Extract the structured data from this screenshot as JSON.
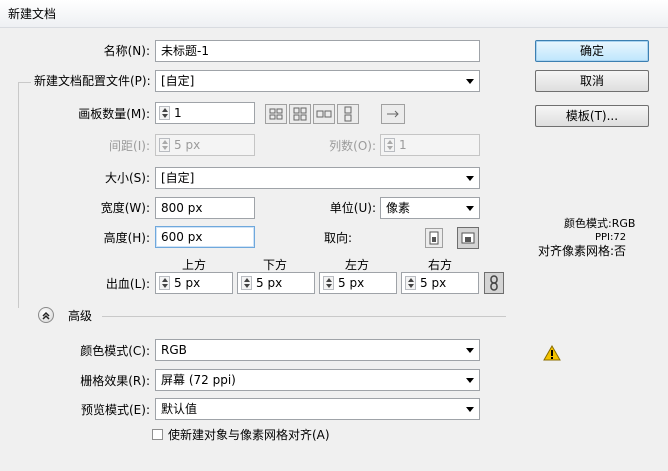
{
  "window": {
    "title": "新建文档"
  },
  "name": {
    "label": "名称(N):",
    "value": "未标题-1"
  },
  "profile": {
    "label": "新建文档配置文件(P):",
    "value": "[自定]"
  },
  "artboards": {
    "count_label": "画板数量(M):",
    "count_value": "1",
    "spacing_label": "间距(I):",
    "spacing_value": "5 px",
    "columns_label": "列数(O):",
    "columns_value": "1"
  },
  "size": {
    "label": "大小(S):",
    "value": "[自定]"
  },
  "width": {
    "label": "宽度(W):",
    "value": "800 px"
  },
  "height": {
    "label": "高度(H):",
    "value": "600 px"
  },
  "units": {
    "label": "单位(U):",
    "value": "像素"
  },
  "orientation": {
    "label": "取向:"
  },
  "bleed": {
    "label": "出血(L):",
    "top_label": "上方",
    "top_value": "5 px",
    "bottom_label": "下方",
    "bottom_value": "5 px",
    "left_label": "左方",
    "left_value": "5 px",
    "right_label": "右方",
    "right_value": "5 px"
  },
  "advanced": {
    "label": "高级",
    "color_mode_label": "颜色模式(C):",
    "color_mode_value": "RGB",
    "raster_label": "栅格效果(R):",
    "raster_value": "屏幕 (72 ppi)",
    "preview_label": "预览模式(E):",
    "preview_value": "默认值",
    "align_checkbox_label": "使新建对象与像素网格对齐(A)"
  },
  "buttons": {
    "ok": "确定",
    "cancel": "取消",
    "templates": "模板(T)..."
  },
  "info": {
    "color_mode": "颜色模式:RGB",
    "ppi": "PPI:72",
    "pixel_grid": "对齐像素网格:否"
  },
  "colors": {
    "warning": "#f3c300",
    "accent": "#3c7fb1"
  }
}
